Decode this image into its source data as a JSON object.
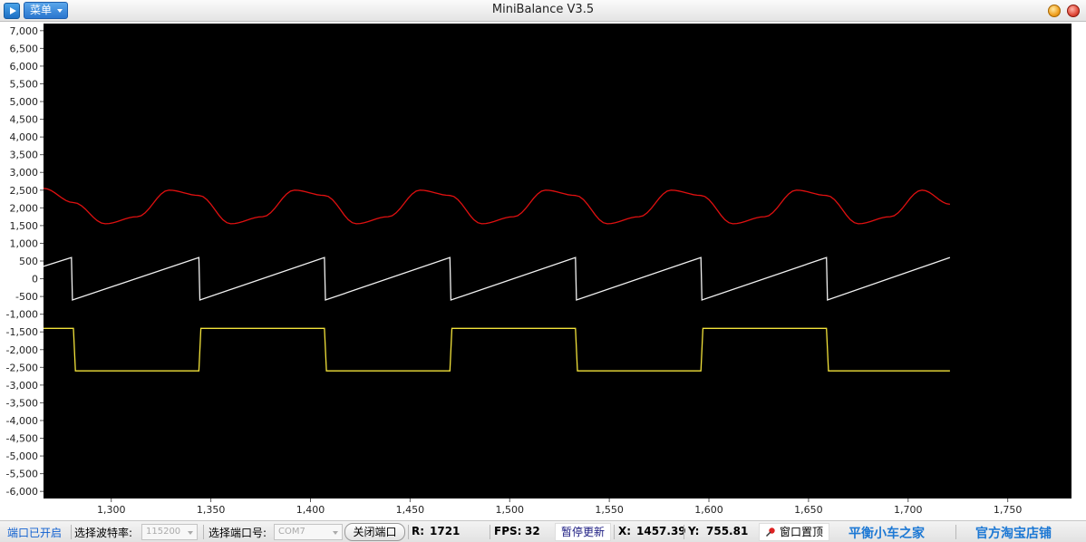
{
  "window": {
    "title": "MiniBalance V3.5",
    "menu_label": "菜单"
  },
  "statusbar": {
    "port_status": "端口已开启",
    "baud_label": "选择波特率:",
    "baud_value": "115200",
    "port_label": "选择端口号:",
    "port_value": "COM7",
    "close_port_button": "关闭端口",
    "r_label": "R:",
    "r_value": "1721",
    "fps_label": "FPS:",
    "fps_value": "32",
    "pause_button": "暂停更新",
    "x_label": "X:",
    "x_value": "1457.39",
    "y_label": "Y:",
    "y_value": "755.81",
    "pin_button": "窗口置顶",
    "link_home": "平衡小车之家",
    "link_shop": "官方淘宝店铺"
  },
  "colors": {
    "plot_background": "#000000",
    "series_red": "#e01010",
    "series_white": "#f2f2f2",
    "series_yellow": "#f2e23a",
    "brand_blue": "#1c78d4",
    "port_status_blue": "#1060d0"
  },
  "chart_data": {
    "type": "line",
    "grid": false,
    "legend": "none",
    "xlim": [
      1266,
      1782
    ],
    "ylim": [
      -6200,
      7200
    ],
    "x_ticks": [
      1300,
      1350,
      1400,
      1450,
      1500,
      1550,
      1600,
      1650,
      1700,
      1750
    ],
    "x_tick_labels": [
      "1,300",
      "1,350",
      "1,400",
      "1,450",
      "1,500",
      "1,550",
      "1,600",
      "1,650",
      "1,700",
      "1,750"
    ],
    "y_ticks": [
      7000,
      6500,
      6000,
      5500,
      5000,
      4500,
      4000,
      3500,
      3000,
      2500,
      2000,
      1500,
      1000,
      500,
      0,
      -500,
      -1000,
      -1500,
      -2000,
      -2500,
      -3000,
      -3500,
      -4000,
      -4500,
      -5000,
      -5500,
      -6000
    ],
    "y_tick_labels": [
      "7,000",
      "6,500",
      "6,000",
      "5,500",
      "5,000",
      "4,500",
      "4,000",
      "3,500",
      "3,000",
      "2,500",
      "2,000",
      "1,500",
      "1,000",
      "500",
      "0",
      "-500",
      "-1,000",
      "-1,500",
      "-2,000",
      "-2,500",
      "-3,000",
      "-3,500",
      "-4,000",
      "-4,500",
      "-5,000",
      "-5,500",
      "-6,000"
    ],
    "series": [
      {
        "kind": "sine",
        "color": "#e01010",
        "x": [
          1266,
          1281,
          1297,
          1313,
          1329,
          1344,
          1360,
          1376,
          1392,
          1407,
          1423,
          1439,
          1455,
          1470,
          1486,
          1502,
          1518,
          1533,
          1549,
          1565,
          1581,
          1596,
          1612,
          1628,
          1644,
          1659,
          1675,
          1691,
          1707,
          1721
        ],
        "y": [
          2550,
          2150,
          1550,
          1750,
          2500,
          2350,
          1550,
          1750,
          2500,
          2350,
          1550,
          1750,
          2500,
          2350,
          1550,
          1750,
          2500,
          2350,
          1550,
          1750,
          2500,
          2350,
          1550,
          1750,
          2500,
          2350,
          1550,
          1750,
          2500,
          2100
        ]
      },
      {
        "kind": "sawtooth",
        "color": "#f2f2f2",
        "x": [
          1266,
          1280,
          1280.5,
          1344,
          1344.5,
          1407,
          1407.5,
          1470,
          1470.5,
          1533,
          1533.5,
          1596,
          1596.5,
          1659,
          1659.5,
          1721
        ],
        "y": [
          350,
          600,
          -600,
          600,
          -600,
          600,
          -600,
          600,
          -600,
          600,
          -600,
          600,
          -600,
          600,
          -600,
          600
        ]
      },
      {
        "kind": "square",
        "color": "#f2e23a",
        "x": [
          1266,
          1281,
          1282,
          1344,
          1345,
          1407,
          1408,
          1470,
          1471,
          1533,
          1534,
          1596,
          1597,
          1659,
          1660,
          1721
        ],
        "y": [
          -1400,
          -1400,
          -2600,
          -2600,
          -1400,
          -1400,
          -2600,
          -2600,
          -1400,
          -1400,
          -2600,
          -2600,
          -1400,
          -1400,
          -2600,
          -2600
        ]
      }
    ]
  }
}
